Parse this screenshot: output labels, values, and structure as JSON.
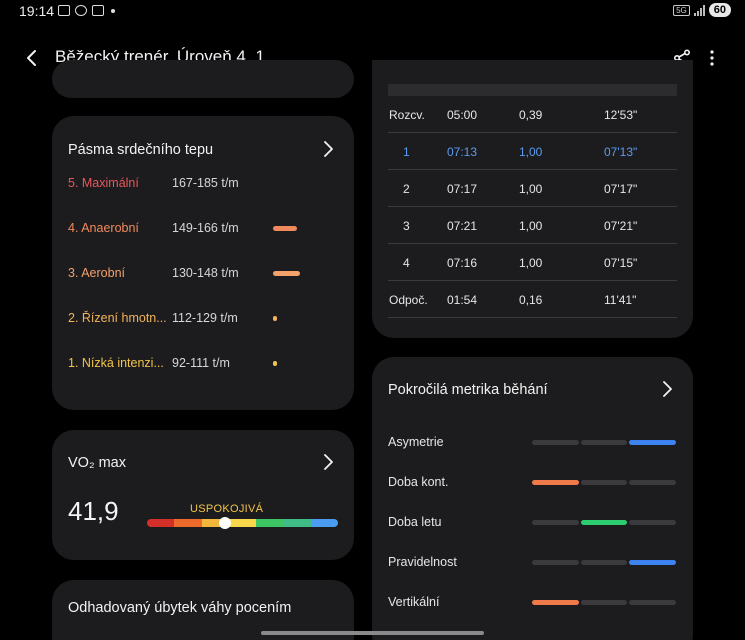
{
  "status": {
    "time": "19:14",
    "network": "5G",
    "battery": "60"
  },
  "header": {
    "title": "Běžecký trenér, Úroveň 4, 1"
  },
  "hr_zones": {
    "title": "Pásma srdečního tepu",
    "zones": [
      {
        "name": "5. Maximální",
        "range": "167-185 t/m",
        "color": "#e8575b",
        "bar_fraction": 0
      },
      {
        "name": "4. Anaerobní",
        "range": "149-166 t/m",
        "color": "#f08a5d",
        "bar_fraction": 0.9
      },
      {
        "name": "3. Aerobní",
        "range": "130-148 t/m",
        "color": "#f3a26b",
        "bar_fraction": 1.0
      },
      {
        "name": "2. Řízení hmotn...",
        "range": "112-129 t/m",
        "color": "#f3b45a",
        "bar_fraction": 0.1
      },
      {
        "name": "1. Nízká intenzi...",
        "range": "92-111 t/m",
        "color": "#f1c44a",
        "bar_fraction": 0.1
      }
    ]
  },
  "splits": {
    "rows": [
      {
        "label": "Rozcv.",
        "time": "05:00",
        "distance": "0,39",
        "pace": "12'53\"",
        "active": false
      },
      {
        "label": "1",
        "time": "07:13",
        "distance": "1,00",
        "pace": "07'13\"",
        "active": true
      },
      {
        "label": "2",
        "time": "07:17",
        "distance": "1,00",
        "pace": "07'17\"",
        "active": false
      },
      {
        "label": "3",
        "time": "07:21",
        "distance": "1,00",
        "pace": "07'21\"",
        "active": false
      },
      {
        "label": "4",
        "time": "07:16",
        "distance": "1,00",
        "pace": "07'15\"",
        "active": false
      },
      {
        "label": "Odpoč.",
        "time": "01:54",
        "distance": "0,16",
        "pace": "11'41\"",
        "active": false
      }
    ],
    "active_color": "#5b9cf0"
  },
  "vo2": {
    "title": "VO₂ max",
    "value": "41,9",
    "level": "USPOKOJIVÁ",
    "scale_colors": [
      "#d3302a",
      "#ee6a2b",
      "#f2b63c",
      "#f7d64a",
      "#3cc463",
      "#3fbb86",
      "#4a9cf0"
    ],
    "position_fraction": 0.41
  },
  "advanced": {
    "title": "Pokročilá metrika běhání",
    "metrics": [
      {
        "label": "Asymetrie",
        "segment": 2,
        "color": "#3c82f0"
      },
      {
        "label": "Doba kont.",
        "segment": 0,
        "color": "#f07a4a"
      },
      {
        "label": "Doba letu",
        "segment": 1,
        "color": "#2ecc71"
      },
      {
        "label": "Pravidelnost",
        "segment": 2,
        "color": "#3c82f0"
      },
      {
        "label": "Vertikální",
        "segment": 0,
        "color": "#f07a4a"
      }
    ]
  },
  "sweat": {
    "title": "Odhadovaný úbytek váhy pocením"
  }
}
